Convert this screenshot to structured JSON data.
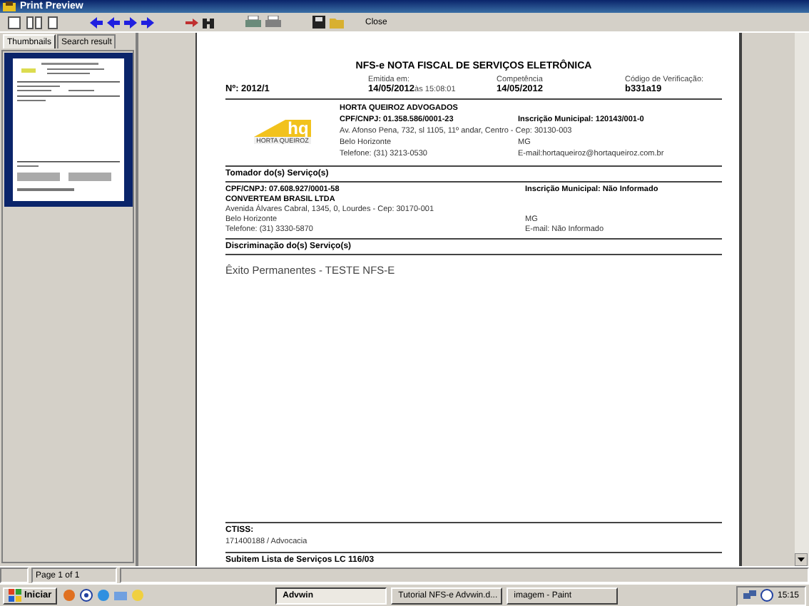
{
  "window": {
    "title": "Print Preview"
  },
  "toolbar": {
    "close_label": "Close"
  },
  "sidebar": {
    "tabs": [
      {
        "label": "Thumbnails",
        "selected": true
      },
      {
        "label": "Search result",
        "selected": false
      }
    ]
  },
  "document": {
    "title": "NFS-e NOTA FISCAL DE SERVIÇOS ELETRÔNICA",
    "number": "Nº: 2012/1",
    "header_fields": [
      {
        "label": "Emitida em:",
        "value": "14/05/2012",
        "suffix": "às 15:08:01"
      },
      {
        "label": "Competência",
        "value": "14/05/2012"
      },
      {
        "label": "Código de Verificação:",
        "value": "b331a19"
      }
    ],
    "provider": {
      "logo": {
        "mark": "hq",
        "name": "HORTA QUEIROZ"
      },
      "rows": [
        {
          "left": "HORTA QUEIROZ ADVOGADOS",
          "bold": true
        },
        {
          "left": "CPF/CNPJ: 01.358.586/0001-23",
          "right": "Inscrição Municipal: 120143/001-0",
          "bold": true
        },
        {
          "left": "Av. Afonso Pena, 732, sl 1105, 11º andar, Centro - Cep: 30130-003",
          "bold": false
        },
        {
          "left": "Belo Horizonte",
          "right": "MG",
          "bold": false
        },
        {
          "left": "Telefone: (31) 3213-0530",
          "right": "E-mail:hortaqueiroz@hortaqueiroz.com.br",
          "bold": false
        }
      ]
    },
    "taker": {
      "title": "Tomador do(s) Serviço(s)",
      "rows": [
        {
          "left": "CPF/CNPJ: 07.608.927/0001-58",
          "right": "Inscrição Municipal: Não Informado",
          "bold": true
        },
        {
          "left": "CONVERTEAM BRASIL LTDA",
          "bold": true
        },
        {
          "left": "Avenida Álvares Cabral, 1345, 0, Lourdes - Cep: 30170-001",
          "bold": false
        },
        {
          "left": "Belo Horizonte",
          "right": "MG",
          "bold": false
        },
        {
          "left": "Telefone: (31) 3330-5870",
          "right": "E-mail: Não Informado",
          "bold": false
        }
      ]
    },
    "services": {
      "title": "Discriminação do(s) Serviço(s)",
      "text": "Êxito Permanentes - TESTE NFS-E"
    },
    "ctiss": {
      "label": "CTISS:",
      "value": "171400188 / Advocacia"
    },
    "subitem_title": "Subitem Lista de Serviços LC 116/03"
  },
  "status_bar": {
    "page": "Page 1 of 1"
  },
  "taskbar": {
    "start": "Iniciar",
    "tasks": [
      {
        "label": "Advwin",
        "selected": true
      },
      {
        "label": "Tutorial NFS-e Advwin.d...",
        "selected": false
      },
      {
        "label": "imagem - Paint",
        "selected": false
      }
    ],
    "clock": "15:15"
  }
}
